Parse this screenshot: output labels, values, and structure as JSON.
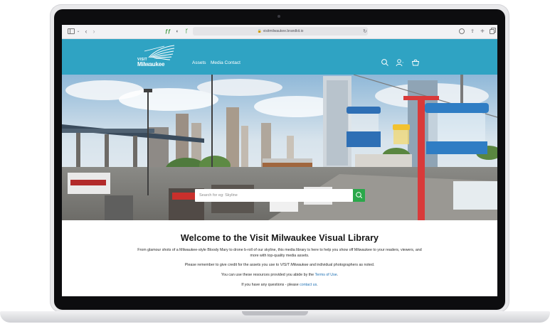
{
  "browser": {
    "url": "visitmilwaukee.brandkit.io"
  },
  "header": {
    "logo": {
      "line1": "VISIT",
      "line2": "Milwaukee"
    },
    "nav": [
      {
        "label": "Assets"
      },
      {
        "label": "Media Contact"
      }
    ],
    "icons": [
      "search-icon",
      "user-icon",
      "cart-icon"
    ]
  },
  "hero": {
    "search_placeholder": "Search for eg: Skyline",
    "button_icon": "search-icon",
    "accent_color": "#2aa84a"
  },
  "content": {
    "title": "Welcome to the Visit Milwaukee Visual Library",
    "paragraph1": "From glamour shots of a Milwaukee-style Bloody Mary to drone b-roll of our skyline, this media library is here to help you show off Milwaukee to your readers, viewers, and more with top-quality media assets.",
    "paragraph2_before": "Please remember to give credit for the assets you use to ",
    "paragraph2_em": "VISIT Milwaukee",
    "paragraph2_after": " and individual photographers as noted.",
    "paragraph3_before": "You can use these resources provided you abide by the ",
    "paragraph3_link": "Terms of Use",
    "paragraph3_after": ".",
    "paragraph4_before": "If you have any questions - please ",
    "paragraph4_link": "contact us",
    "paragraph4_after": "."
  },
  "colors": {
    "header_bg": "#2fa3c3",
    "link": "#1c6fb3"
  }
}
